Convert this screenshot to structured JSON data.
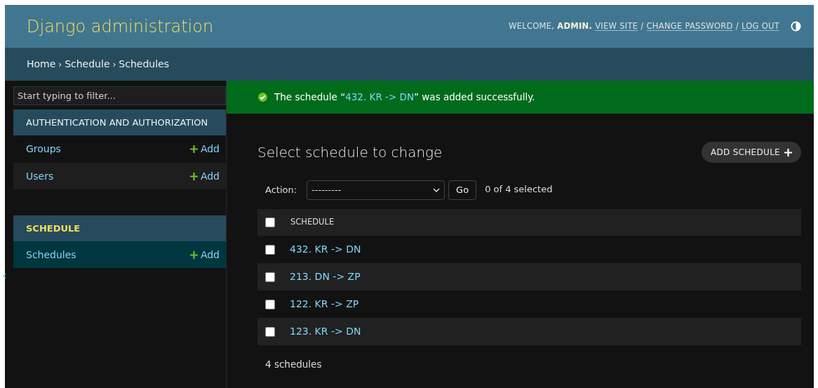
{
  "header": {
    "title": "Django administration",
    "welcome": "WELCOME,",
    "user": "ADMIN.",
    "links": [
      "VIEW SITE",
      "CHANGE PASSWORD",
      "LOG OUT"
    ],
    "separators": [
      "/",
      "/"
    ]
  },
  "breadcrumbs": [
    "Home",
    "Schedule",
    "Schedules"
  ],
  "breadcrumb_separators": [
    "›",
    "›"
  ],
  "sidebar": {
    "filter_placeholder": "Start typing to filter...",
    "toggle": "‹",
    "apps": [
      {
        "name": "AUTHENTICATION AND AUTHORIZATION",
        "selected": false,
        "models": [
          {
            "name": "Groups",
            "add": "Add",
            "selected": false
          },
          {
            "name": "Users",
            "add": "Add",
            "selected": false
          }
        ]
      },
      {
        "name": "SCHEDULE",
        "selected": true,
        "models": [
          {
            "name": "Schedules",
            "add": "Add",
            "selected": true
          }
        ]
      }
    ]
  },
  "message": {
    "before": "The schedule “",
    "link": "432. KR -> DN",
    "after": "” was added successfully."
  },
  "content": {
    "title": "Select schedule to change",
    "add_button": "ADD SCHEDULE",
    "actions": {
      "label": "Action:",
      "value": "---------",
      "go": "Go",
      "counter": "0 of 4 selected"
    },
    "table": {
      "header": {
        "label": "SCHEDULE",
        "checked": false
      },
      "rows": [
        {
          "label": "432. KR -> DN",
          "checked": false
        },
        {
          "label": "213. DN -> ZP",
          "checked": false
        },
        {
          "label": "122. KR -> ZP",
          "checked": false
        },
        {
          "label": "123. KR -> DN",
          "checked": false
        }
      ]
    },
    "footer": "4 schedules"
  }
}
